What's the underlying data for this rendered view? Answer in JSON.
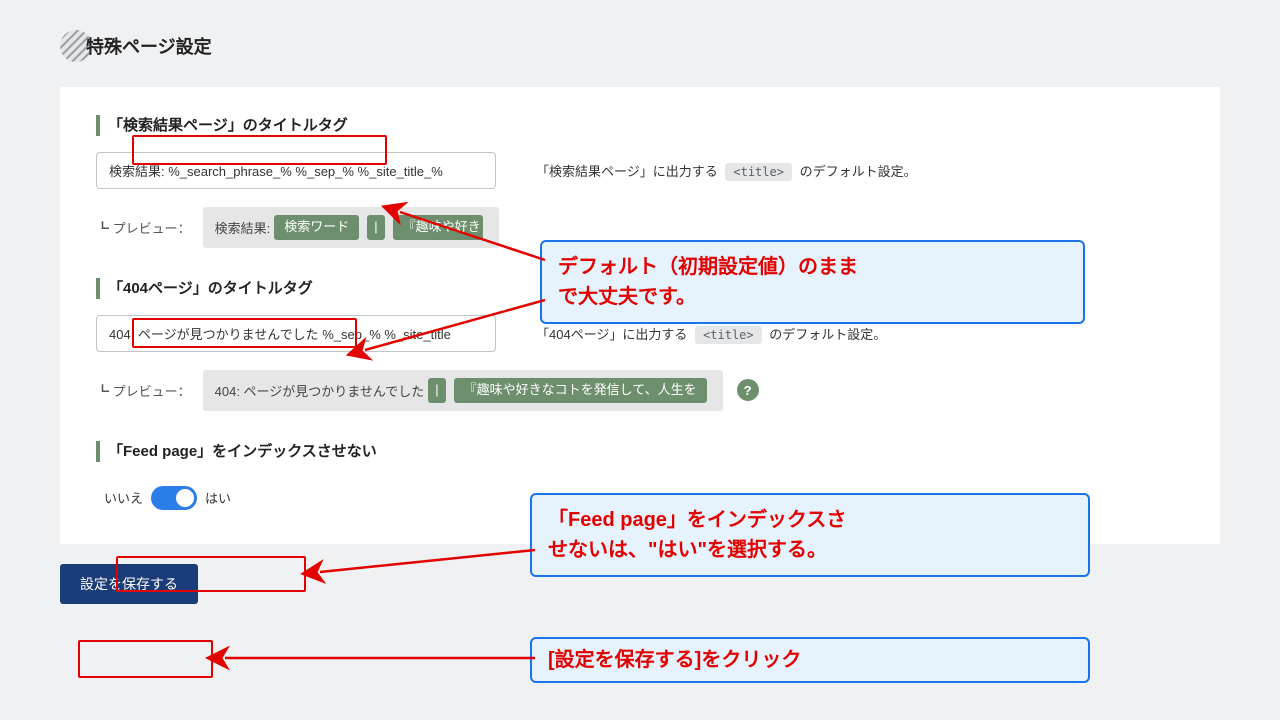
{
  "page": {
    "title": "特殊ページ設定"
  },
  "section1": {
    "label": "「検索結果ページ」のタイトルタグ",
    "input_value": "検索結果: %_search_phrase_% %_sep_% %_site_title_%",
    "help_pre": "「検索結果ページ」に出力する",
    "help_code": "<title>",
    "help_post": "のデフォルト設定。",
    "preview_label": "┗ プレビュー：",
    "preview_prefix": "検索結果:",
    "preview_badge1": "検索ワード",
    "preview_sep": "|",
    "preview_badge2": "『趣味や好き"
  },
  "section2": {
    "label": "「404ページ」のタイトルタグ",
    "input_value": "404: ページが見つかりませんでした %_sep_% %_site_title",
    "help_pre": "「404ページ」に出力する",
    "help_code": "<title>",
    "help_post": "のデフォルト設定。",
    "preview_label": "┗ プレビュー：",
    "preview_prefix": "404: ページが見つかりませんでした",
    "preview_sep": "|",
    "preview_badge2": "『趣味や好きなコトを発信して、人生を",
    "help_icon": "?"
  },
  "section3": {
    "label": "「Feed page」をインデックスさせない",
    "toggle_no": "いいえ",
    "toggle_yes": "はい"
  },
  "save": {
    "label": "設定を保存する"
  },
  "annot": {
    "a1a": "デフォルト（初期設定値）のまま",
    "a1b": "で大丈夫です。",
    "a2a": "「Feed page」をインデックスさ",
    "a2b": "せないは、\"はい\"を選択する。",
    "a3": "[設定を保存する]をクリック"
  }
}
